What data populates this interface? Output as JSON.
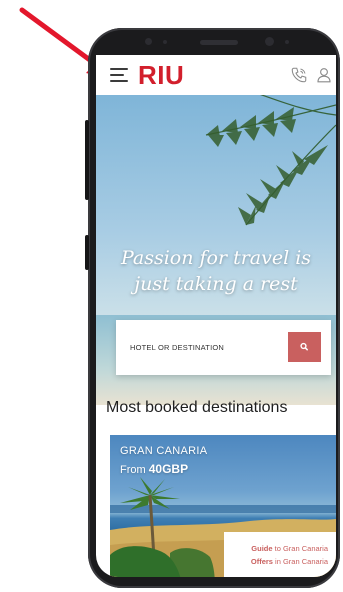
{
  "header": {
    "logo": "RIU",
    "menu_icon": "hamburger-menu-icon",
    "phone_icon": "phone-icon",
    "user_icon": "user-icon"
  },
  "hero": {
    "tagline_line1": "Passion for travel is",
    "tagline_line2": "just taking a rest"
  },
  "search": {
    "placeholder": "HOTEL OR DESTINATION",
    "button_icon": "search-icon"
  },
  "section": {
    "title": "Most booked destinations"
  },
  "destination": {
    "name": "GRAN CANARIA",
    "price_prefix": "From",
    "price_value": "40GBP",
    "guide_lead": "Guide",
    "guide_rest": " to Gran Canaria",
    "offers_lead": "Offers",
    "offers_rest": " in Gran Canaria"
  },
  "colors": {
    "brand_red": "#d21f2c",
    "search_button": "#c9605f",
    "arrow_red": "#e3172c"
  }
}
